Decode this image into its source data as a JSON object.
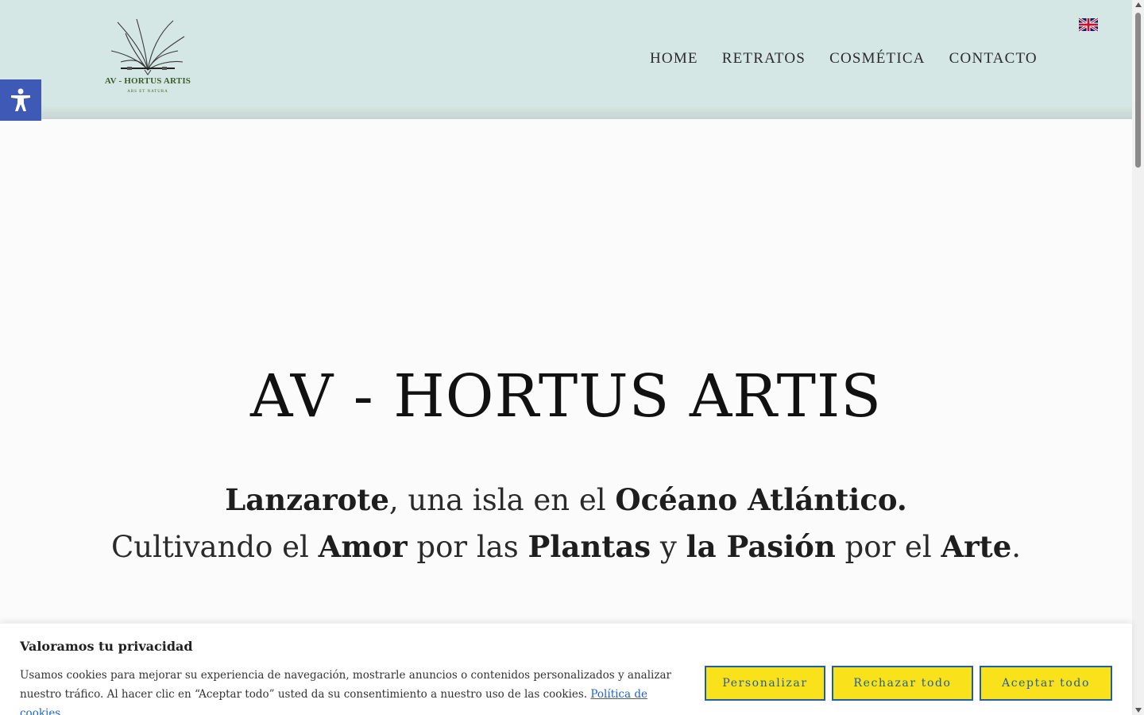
{
  "header": {
    "logo_title": "AV - HORTUS ARTIS",
    "logo_subtitle": "ARS ET NATURA",
    "nav": [
      {
        "label": "HOME"
      },
      {
        "label": "RETRATOS"
      },
      {
        "label": "COSMÉTICA"
      },
      {
        "label": "CONTACTO"
      }
    ],
    "language_icon": "uk-flag-icon"
  },
  "accessibility": {
    "icon": "accessibility-person-icon",
    "color": "#3f59b7"
  },
  "hero": {
    "title": "AV - HORTUS ARTIS",
    "line1": [
      {
        "text": "Lanzarote",
        "bold": true
      },
      {
        "text": ", una isla en el ",
        "bold": false
      },
      {
        "text": "Océano Atlántico.",
        "bold": true
      }
    ],
    "line2": [
      {
        "text": "Cultivando el ",
        "bold": false
      },
      {
        "text": "Amor",
        "bold": true
      },
      {
        "text": " por las ",
        "bold": false
      },
      {
        "text": "Plantas",
        "bold": true
      },
      {
        "text": " y ",
        "bold": false
      },
      {
        "text": "la Pasión",
        "bold": true
      },
      {
        "text": " por el ",
        "bold": false
      },
      {
        "text": "Arte",
        "bold": true
      },
      {
        "text": ".",
        "bold": false
      }
    ]
  },
  "cookie": {
    "title": "Valoramos tu privacidad",
    "text": "Usamos cookies para mejorar su experiencia de navegación, mostrarle anuncios o contenidos personalizados y analizar nuestro tráfico. Al hacer clic en “Aceptar todo” usted da su consentimiento a nuestro uso de las cookies. ",
    "policy_link": "Política de cookies",
    "customize_label": "Personalizar",
    "reject_label": "Rechazar todo",
    "accept_label": "Aceptar todo",
    "button_color": "#f9e21c",
    "button_text_color": "#1e5ea8"
  },
  "colors": {
    "header_bg": "#d5e7e4",
    "page_bg": "#fbfbfb"
  }
}
